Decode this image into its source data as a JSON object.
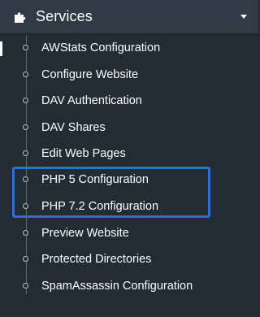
{
  "section": {
    "title": "Services",
    "icon": "puzzle-icon",
    "expanded": true
  },
  "items": [
    {
      "label": "AWStats Configuration"
    },
    {
      "label": "Configure Website"
    },
    {
      "label": "DAV Authentication"
    },
    {
      "label": "DAV Shares"
    },
    {
      "label": "Edit Web Pages"
    },
    {
      "label": "PHP 5 Configuration"
    },
    {
      "label": "PHP 7.2 Configuration"
    },
    {
      "label": "Preview Website"
    },
    {
      "label": "Protected Directories"
    },
    {
      "label": "SpamAssassin Configuration"
    }
  ],
  "colors": {
    "background": "#232b33",
    "header": "#323b45",
    "text": "#ffffff",
    "highlight": "#1f6ff0"
  }
}
